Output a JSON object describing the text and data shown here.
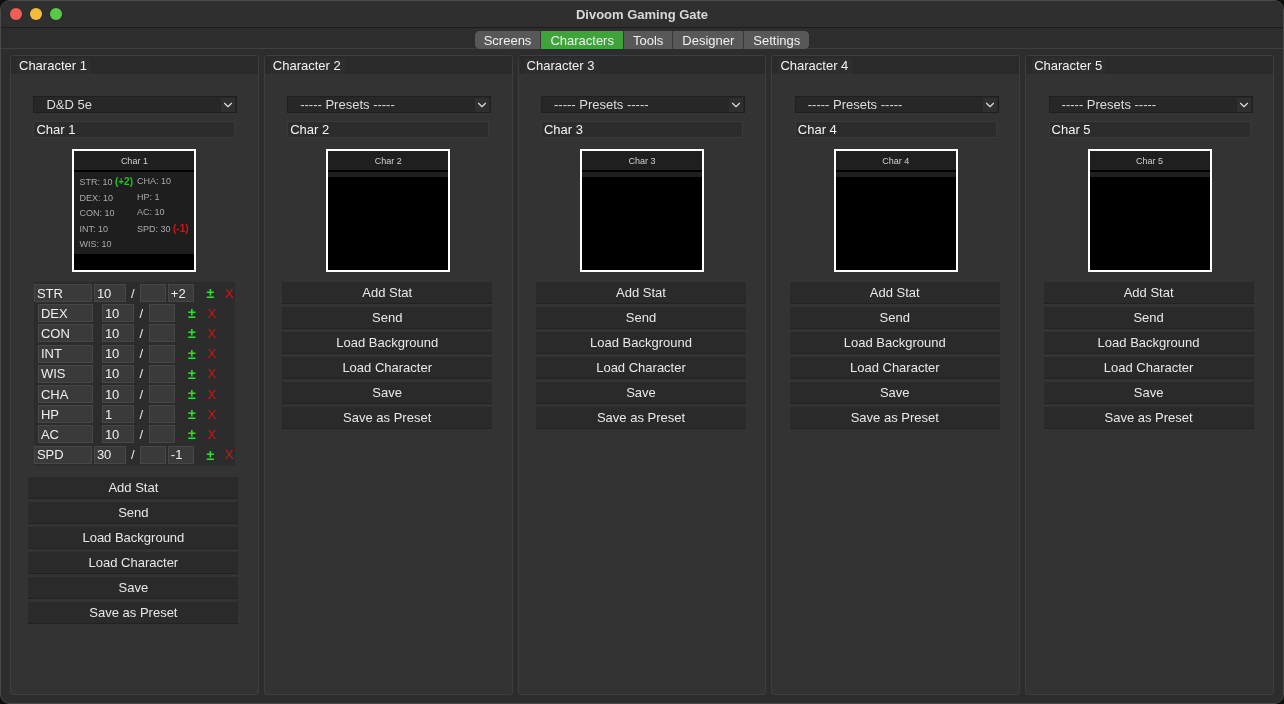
{
  "window": {
    "title": "Divoom Gaming Gate"
  },
  "tabs": [
    {
      "label": "Screens",
      "selected": false
    },
    {
      "label": "Characters",
      "selected": true
    },
    {
      "label": "Tools",
      "selected": false
    },
    {
      "label": "Designer",
      "selected": false
    },
    {
      "label": "Settings",
      "selected": false
    }
  ],
  "panels": [
    {
      "title": "Character 1",
      "preset": "D&D 5e",
      "name": "Char 1",
      "preview": {
        "title": "Char 1",
        "columns": [
          [
            {
              "text": "STR: 10",
              "bonus": {
                "text": "(+2)",
                "color": "#22c322"
              }
            },
            {
              "text": "DEX: 10"
            },
            {
              "text": "CON: 10"
            },
            {
              "text": "INT: 10"
            },
            {
              "text": "WIS: 10"
            }
          ],
          [
            {
              "text": "CHA: 10"
            },
            {
              "text": "HP: 1"
            },
            {
              "text": "AC: 10"
            },
            {
              "text": "SPD: 30",
              "bonus": {
                "text": "(-1)",
                "color": "#d01818"
              }
            }
          ]
        ]
      },
      "stats": [
        {
          "kind": "modified",
          "name": "STR",
          "value": "10",
          "slash": "/",
          "modifier": "+2",
          "adjust": "±",
          "remove": "X"
        },
        {
          "kind": "plain",
          "name": "DEX",
          "value": "10",
          "slash": "/",
          "adjust": "±",
          "remove": "X"
        },
        {
          "kind": "plain",
          "name": "CON",
          "value": "10",
          "slash": "/",
          "adjust": "±",
          "remove": "X"
        },
        {
          "kind": "plain",
          "name": "INT",
          "value": "10",
          "slash": "/",
          "adjust": "±",
          "remove": "X"
        },
        {
          "kind": "plain",
          "name": "WIS",
          "value": "10",
          "slash": "/",
          "adjust": "±",
          "remove": "X"
        },
        {
          "kind": "plain",
          "name": "CHA",
          "value": "10",
          "slash": "/",
          "adjust": "±",
          "remove": "X"
        },
        {
          "kind": "plain",
          "name": "HP",
          "value": "1",
          "slash": "/",
          "adjust": "±",
          "remove": "X"
        },
        {
          "kind": "plain",
          "name": "AC",
          "value": "10",
          "slash": "/",
          "adjust": "±",
          "remove": "X"
        },
        {
          "kind": "modified",
          "name": "SPD",
          "value": "30",
          "slash": "/",
          "modifier": "-1",
          "adjust": "±",
          "remove": "X"
        }
      ],
      "buttons": [
        "Add Stat",
        "Send",
        "Load Background",
        "Load Character",
        "Save",
        "Save as Preset"
      ]
    },
    {
      "title": "Character 2",
      "preset": "----- Presets -----",
      "name": "Char 2",
      "preview": {
        "title": "Char 2"
      },
      "buttons": [
        "Add Stat",
        "Send",
        "Load Background",
        "Load Character",
        "Save",
        "Save as Preset"
      ]
    },
    {
      "title": "Character 3",
      "preset": "----- Presets -----",
      "name": "Char 3",
      "preview": {
        "title": "Char 3"
      },
      "buttons": [
        "Add Stat",
        "Send",
        "Load Background",
        "Load Character",
        "Save",
        "Save as Preset"
      ]
    },
    {
      "title": "Character 4",
      "preset": "----- Presets -----",
      "name": "Char 4",
      "preview": {
        "title": "Char 4"
      },
      "buttons": [
        "Add Stat",
        "Send",
        "Load Background",
        "Load Character",
        "Save",
        "Save as Preset"
      ]
    },
    {
      "title": "Character 5",
      "preset": "----- Presets -----",
      "name": "Char 5",
      "preview": {
        "title": "Char 5"
      },
      "buttons": [
        "Add Stat",
        "Send",
        "Load Background",
        "Load Character",
        "Save",
        "Save as Preset"
      ]
    }
  ]
}
